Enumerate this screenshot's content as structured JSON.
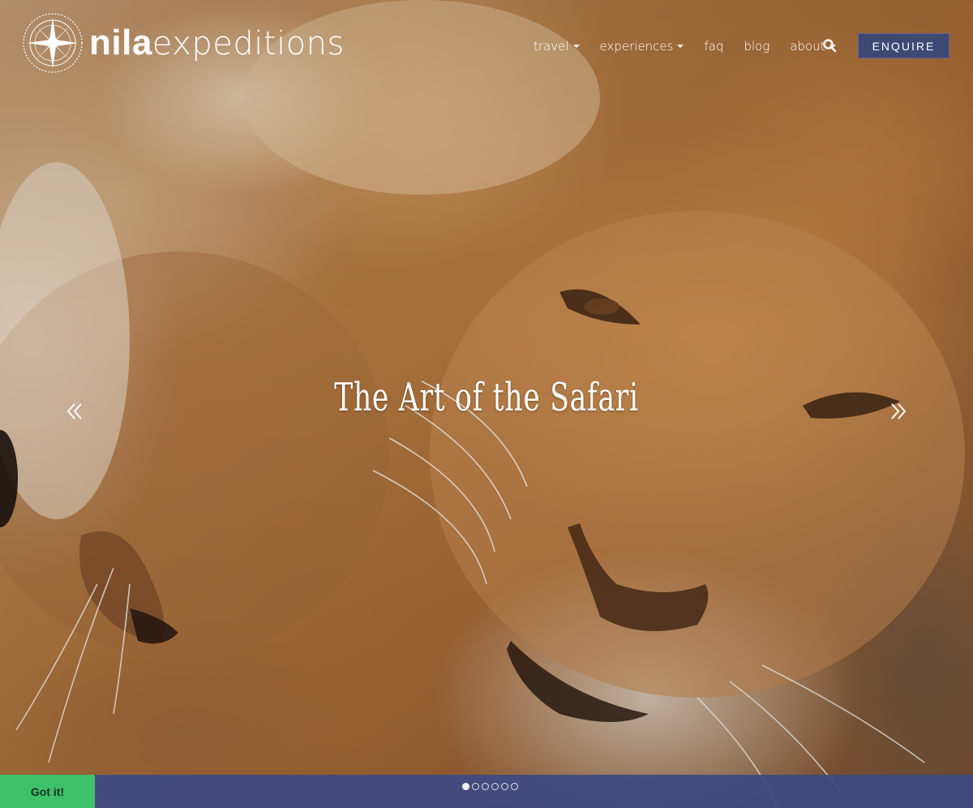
{
  "brand": {
    "name_bold": "nila",
    "name_light": "expeditions"
  },
  "nav": {
    "items": [
      {
        "label": "travel",
        "has_dropdown": true
      },
      {
        "label": "experiences",
        "has_dropdown": true
      },
      {
        "label": "faq",
        "has_dropdown": false
      },
      {
        "label": "blog",
        "has_dropdown": false
      },
      {
        "label": "about",
        "has_dropdown": true
      }
    ],
    "search_icon": "search-icon",
    "enquire_label": "ENQUIRE"
  },
  "hero": {
    "caption": "The Art of the Safari",
    "prev_icon": "double-chevron-left-icon",
    "next_icon": "double-chevron-right-icon",
    "slide_count": 6,
    "active_slide": 1
  },
  "cookie": {
    "accept_label": "Got it!"
  },
  "colors": {
    "accent": "#3f4773",
    "cookie_bar": "#3f4882",
    "accept_button": "#3fc06a"
  }
}
